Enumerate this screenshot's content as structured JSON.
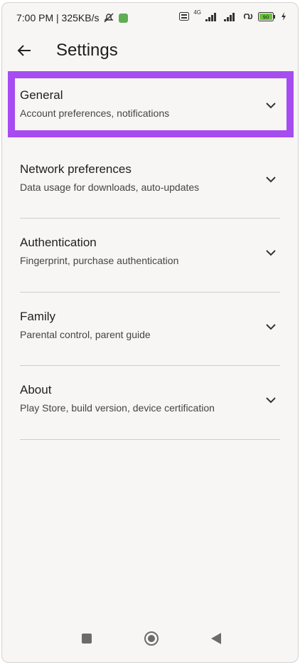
{
  "status_bar": {
    "time_speed": "7:00 PM | 325KB/s",
    "network_type": "4G",
    "battery_level": "90"
  },
  "app_bar": {
    "title": "Settings"
  },
  "settings": [
    {
      "title": "General",
      "subtitle": "Account preferences, notifications"
    },
    {
      "title": "Network preferences",
      "subtitle": "Data usage for downloads, auto-updates"
    },
    {
      "title": "Authentication",
      "subtitle": "Fingerprint, purchase authentication"
    },
    {
      "title": "Family",
      "subtitle": "Parental control, parent guide"
    },
    {
      "title": "About",
      "subtitle": "Play Store, build version, device certification"
    }
  ],
  "colors": {
    "highlight": "#a64cf0",
    "background": "#f8f6f4"
  },
  "icons": {
    "back": "arrow-back-icon",
    "expand": "chevron-down-icon",
    "nav_recents": "square-icon",
    "nav_home": "circle-icon",
    "nav_back": "triangle-icon"
  }
}
